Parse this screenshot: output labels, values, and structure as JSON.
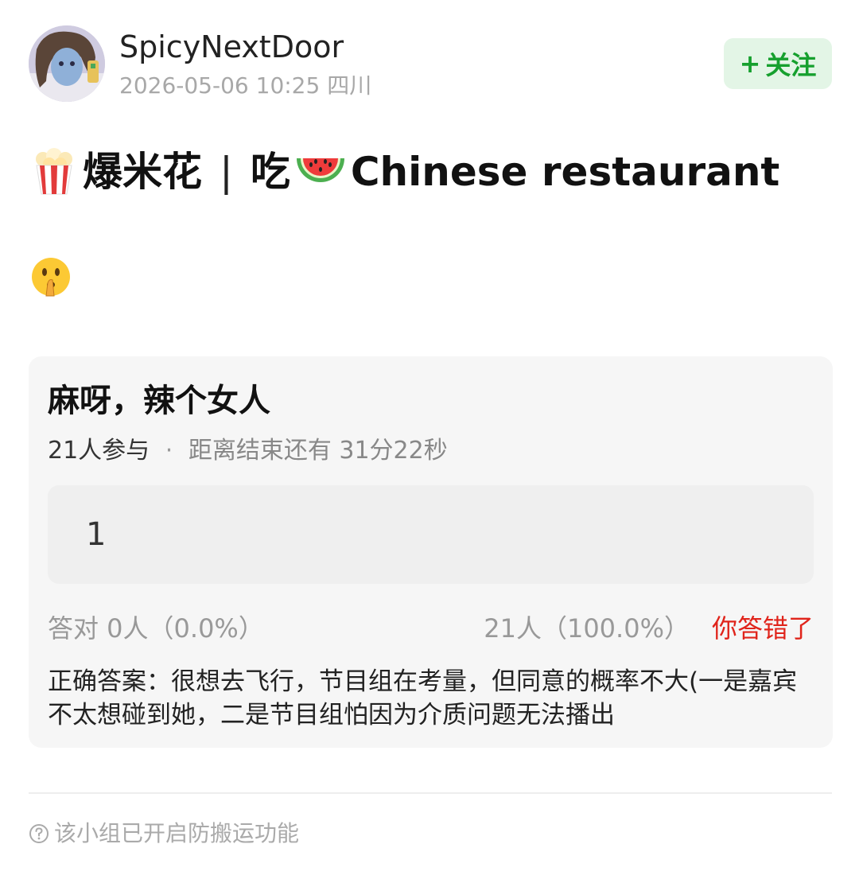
{
  "author": {
    "username": "SpicyNextDoor",
    "datetime": "2026-05-06 10:25",
    "location": "四川",
    "follow_label": "关注",
    "follow_plus": "+"
  },
  "post": {
    "title_part1": "爆米花",
    "title_sep": "|",
    "title_part2": "吃",
    "title_part3": "Chinese restaurant",
    "title_emojis": [
      "popcorn-emoji",
      "watermelon-emoji"
    ],
    "body_emoji": "shushing-face-emoji"
  },
  "quiz": {
    "title": "麻呀，辣个女人",
    "participants": "21人参与",
    "separator": "·",
    "remaining": "距离结束还有 31分22秒",
    "option_label": "1",
    "correct_stats": "答对  0人（0.0%）",
    "option_stats": "21人（100.0%）",
    "wrong_label": "你答错了",
    "answer_text": "正确答案：很想去飞行，节目组在考量，但同意的概率不大(一是嘉宾不太想碰到她，二是节目组怕因为介质问题无法播出"
  },
  "footer": {
    "notice": "该小组已开启防搬运功能",
    "notice_icon": "question-circle-icon"
  },
  "colors": {
    "follow_bg": "#e3f5e6",
    "follow_text": "#16a02e",
    "wrong": "#e0241b",
    "card_bg": "#f6f6f6"
  }
}
